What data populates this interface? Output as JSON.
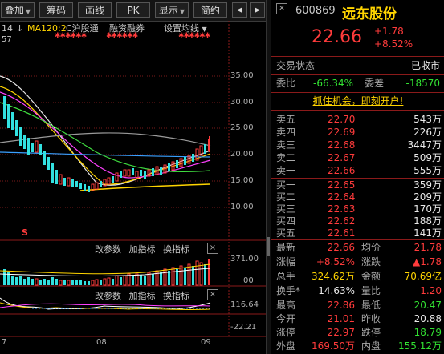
{
  "toolbar": {
    "buttons": [
      {
        "label": "叠加",
        "caret": "▼"
      },
      {
        "label": "筹码"
      },
      {
        "label": "画线"
      },
      {
        "label": "PK"
      },
      {
        "label": "显示",
        "caret": "▼"
      },
      {
        "label": "简约"
      }
    ],
    "prev": "◀",
    "next": "▶"
  },
  "indicator_line": {
    "period_num": "14",
    "arrow": "↓",
    "ma_label": "MA120:2",
    "tag1": "C沪股通",
    "tag2": "融资融券",
    "tag3": "设置均线",
    "tag3_caret": "▼",
    "left_value": "57"
  },
  "main_yaxis": [
    "35.00",
    "30.00",
    "25.00",
    "20.00",
    "15.00",
    "10.00"
  ],
  "marker": "S",
  "volume_panel": {
    "tabs": [
      "改参数",
      "加指标",
      "换指标"
    ],
    "close": "×",
    "yticks": [
      "371.00",
      "00"
    ]
  },
  "osc_panel": {
    "tabs": [
      "改参数",
      "加指标",
      "换指标"
    ],
    "close": "×",
    "yticks": [
      "116.64",
      "-22.21"
    ]
  },
  "date_axis": [
    "7",
    "08",
    "09"
  ],
  "stock": {
    "code": "600869",
    "name": "远东股份",
    "price": "22.66",
    "change": "+1.78",
    "change_pct": "+8.52%"
  },
  "status": {
    "label": "交易状态",
    "value": "已收市"
  },
  "ratio": {
    "wb_label": "委比",
    "wb_value": "-66.34%",
    "wc_label": "委差",
    "wc_value": "-18570"
  },
  "promo": "抓住机会，即刻开户!",
  "asks": [
    {
      "label": "卖五",
      "price": "22.70",
      "vol": "543万"
    },
    {
      "label": "卖四",
      "price": "22.69",
      "vol": "226万"
    },
    {
      "label": "卖三",
      "price": "22.68",
      "vol": "3447万"
    },
    {
      "label": "卖二",
      "price": "22.67",
      "vol": "509万"
    },
    {
      "label": "卖一",
      "price": "22.66",
      "vol": "555万"
    }
  ],
  "bids": [
    {
      "label": "买一",
      "price": "22.65",
      "vol": "359万"
    },
    {
      "label": "买二",
      "price": "22.64",
      "vol": "209万"
    },
    {
      "label": "买三",
      "price": "22.63",
      "vol": "170万"
    },
    {
      "label": "买四",
      "price": "22.62",
      "vol": "188万"
    },
    {
      "label": "买五",
      "price": "22.61",
      "vol": "141万"
    }
  ],
  "stats": [
    {
      "l1": "最新",
      "v1": "22.66",
      "c1": "red",
      "l2": "均价",
      "v2": "21.78",
      "c2": "red"
    },
    {
      "l1": "涨幅",
      "v1": "+8.52%",
      "c1": "red",
      "l2": "涨跌",
      "v2": "▲1.78",
      "c2": "red"
    },
    {
      "l1": "总手",
      "v1": "324.62万",
      "c1": "yellow",
      "l2": "金额",
      "v2": "70.69亿",
      "c2": "yellow"
    },
    {
      "l1": "换手*",
      "v1": "14.63%",
      "c1": "white",
      "l2": "量比",
      "v2": "1.20",
      "c2": "red"
    },
    {
      "l1": "最高",
      "v1": "22.86",
      "c1": "red",
      "l2": "最低",
      "v2": "20.47",
      "c2": "green"
    },
    {
      "l1": "今开",
      "v1": "21.01",
      "c1": "red",
      "l2": "昨收",
      "v2": "20.88",
      "c2": "white"
    },
    {
      "l1": "涨停",
      "v1": "22.97",
      "c1": "red",
      "l2": "跌停",
      "v2": "18.79",
      "c2": "green"
    },
    {
      "l1": "外盘",
      "v1": "169.50万",
      "c1": "red",
      "l2": "内盘",
      "v2": "155.12万",
      "c2": "green"
    }
  ],
  "colors": {
    "up": "#ff3b3b",
    "down": "#32e132",
    "volume": "#ffd400",
    "accent": "#ffd400"
  }
}
